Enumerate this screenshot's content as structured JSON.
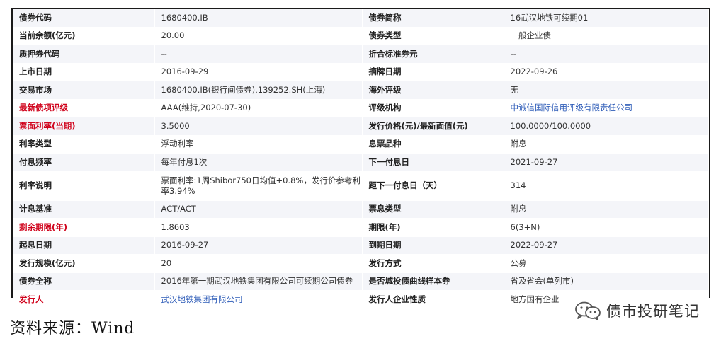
{
  "rows": [
    {
      "k1": "债券代码",
      "v1": "1680400.IB",
      "k2": "债券简称",
      "v2": "16武汉地铁可续期01"
    },
    {
      "k1": "当前余额(亿元)",
      "v1": "20.00",
      "k2": "债券类型",
      "v2": "一般企业债"
    },
    {
      "k1": "质押券代码",
      "v1": "--",
      "k2": "折合标准券元",
      "v2": "--"
    },
    {
      "k1": "上市日期",
      "v1": "2016-09-29",
      "k2": "摘牌日期",
      "v2": "2022-09-26"
    },
    {
      "k1": "交易市场",
      "v1": "1680400.IB(银行间债券),139252.SH(上海)",
      "k2": "海外评级",
      "v2": "无"
    },
    {
      "k1": "最新债项评级",
      "v1": "AAA(维持,2020-07-30)",
      "k2": "评级机构",
      "v2": "中诚信国际信用评级有限责任公司"
    },
    {
      "k1": "票面利率(当期)",
      "v1": "3.5000",
      "k2": "发行价格(元)/最新面值(元)",
      "v2": "100.0000/100.0000"
    },
    {
      "k1": "利率类型",
      "v1": "浮动利率",
      "k2": "息票品种",
      "v2": "附息"
    },
    {
      "k1": "付息频率",
      "v1": "每年付息1次",
      "k2": "下一付息日",
      "v2": "2021-09-27"
    },
    {
      "k1": "利率说明",
      "v1": "票面利率:1周Shibor750日均值+0.8%，发行价参考利率3.94%",
      "k2": "距下一付息日（天）",
      "v2": "314"
    },
    {
      "k1": "计息基准",
      "v1": "ACT/ACT",
      "k2": "票息类型",
      "v2": "附息"
    },
    {
      "k1": "剩余期限(年)",
      "v1": "1.8603",
      "k2": "期限(年)",
      "v2": "6(3+N)"
    },
    {
      "k1": "起息日期",
      "v1": "2016-09-27",
      "k2": "到期日期",
      "v2": "2022-09-27"
    },
    {
      "k1": "发行规模(亿元)",
      "v1": "20",
      "k2": "发行方式",
      "v2": "公募"
    },
    {
      "k1": "债券全称",
      "v1": "2016年第一期武汉地铁集团有限公司可续期公司债券",
      "k2": "是否城投债曲线样本券",
      "v2": "省及省会(单列市)"
    },
    {
      "k1": "发行人",
      "v1": "武汉地铁集团有限公司",
      "k2": "发行人企业性质",
      "v2": "地方国有企业"
    }
  ],
  "source": "资料来源：Wind",
  "watermark": {
    "text": "债市投研笔记",
    "icon": "wechat-icon"
  },
  "colors": {
    "highlight_label": "#d0021b",
    "link": "#2e5cb8",
    "row_stripe": "#f4f5f9"
  }
}
